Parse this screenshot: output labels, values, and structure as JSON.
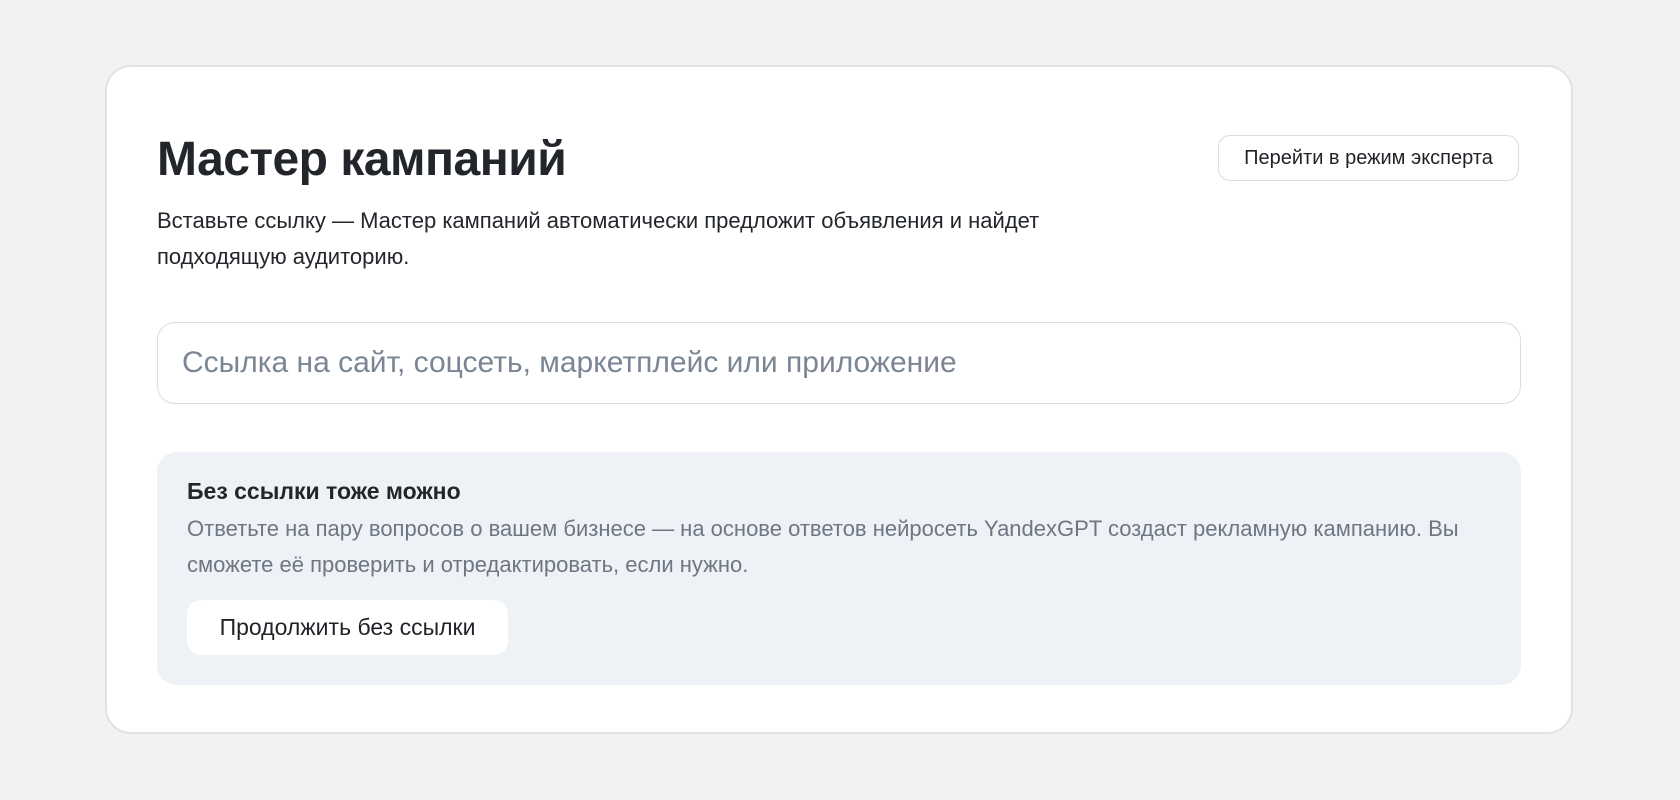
{
  "wizard": {
    "title": "Мастер кампаний",
    "subtitle": "Вставьте ссылку — Мастер кампаний автоматически предложит объявления и найдет подходящую аудиторию.",
    "expert_mode_label": "Перейти в режим эксперта",
    "link_input": {
      "value": "",
      "placeholder": "Ссылка на сайт, соцсеть, маркетплейс или приложение"
    },
    "no_link": {
      "title": "Без ссылки тоже можно",
      "text": "Ответьте на пару вопросов о вашем бизнесе — на основе ответов нейросеть YandexGPT создаст рекламную кампанию. Вы сможете её проверить и отредактировать, если нужно.",
      "button_label": "Продолжить без ссылки"
    }
  },
  "colors": {
    "page_background": "#f2f2f2",
    "card_background": "#ffffff",
    "info_background": "#eef1f6",
    "muted_text": "#6e7684",
    "placeholder_text": "#7b8594"
  }
}
